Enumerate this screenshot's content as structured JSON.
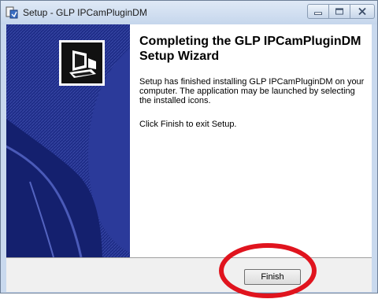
{
  "window": {
    "title": "Setup - GLP IPCamPluginDM"
  },
  "title_controls": {
    "minimize_icon": "minimize-icon",
    "maximize_icon": "maximize-icon",
    "close_icon": "close-icon"
  },
  "wizard": {
    "heading": "Completing the GLP IPCamPluginDM Setup Wizard",
    "message": "Setup has finished installing GLP IPCamPluginDM on your computer. The application may be launched by selecting the installed icons.",
    "instruction": "Click Finish to exit Setup."
  },
  "buttons": {
    "finish_label": "Finish"
  },
  "colors": {
    "side_panel": "#1e2c87",
    "highlight_circle": "#e0141e"
  }
}
